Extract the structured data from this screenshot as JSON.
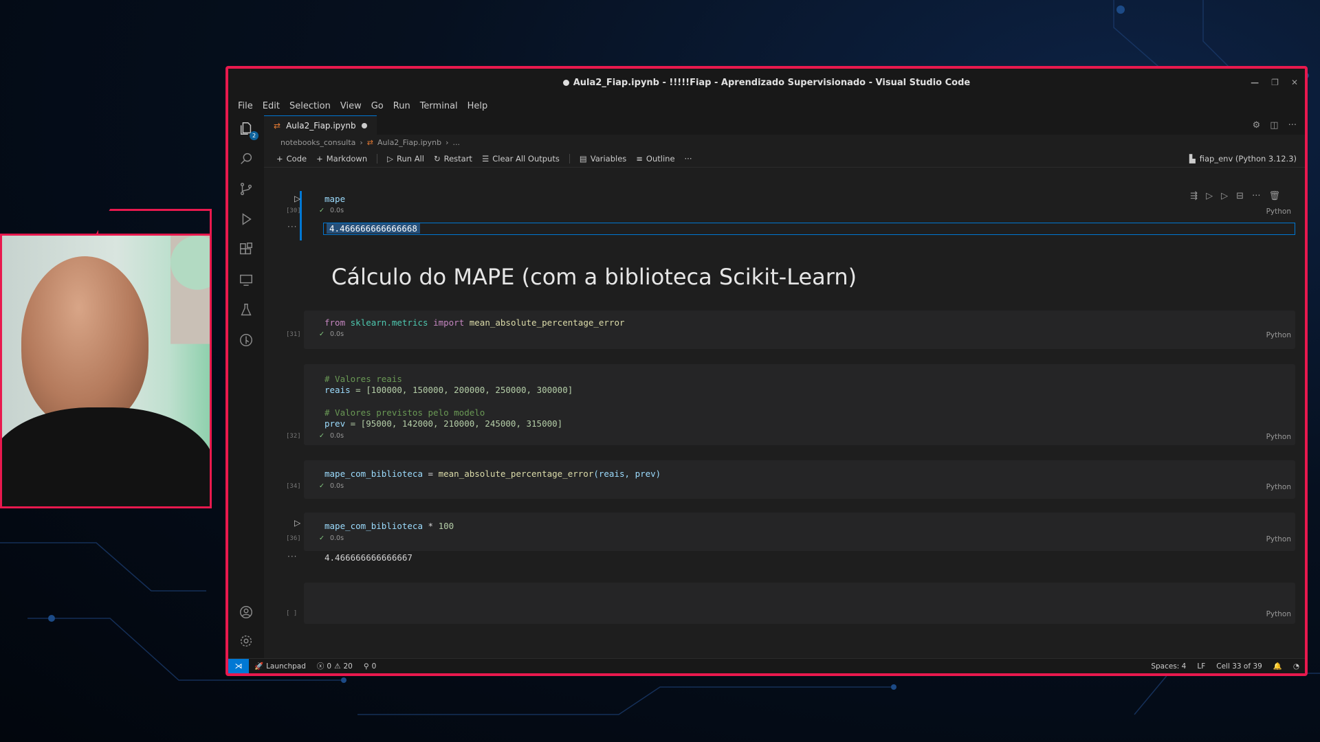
{
  "window": {
    "title": "Aula2_Fiap.ipynb - !!!!!Fiap - Aprendizado Supervisionado - Visual Studio Code"
  },
  "menu": [
    "File",
    "Edit",
    "Selection",
    "View",
    "Go",
    "Run",
    "Terminal",
    "Help"
  ],
  "tab": {
    "label": "Aula2_Fiap.ipynb"
  },
  "breadcrumb": [
    "notebooks_consulta",
    "Aula2_Fiap.ipynb",
    "..."
  ],
  "notebook_toolbar": {
    "code": "Code",
    "markdown": "Markdown",
    "run_all": "Run All",
    "restart": "Restart",
    "clear_outputs": "Clear All Outputs",
    "variables": "Variables",
    "outline": "Outline",
    "more": "···",
    "kernel": "fiap_env (Python 3.12.3)"
  },
  "cells": {
    "c1": {
      "code": "mape",
      "exec": "[30]",
      "time": "0.0s",
      "lang": "Python",
      "output": "4.466666666666668"
    },
    "heading": "Cálculo do MAPE (com a biblioteca Scikit-Learn)",
    "c2": {
      "code_kw1": "from",
      "code_mod": "sklearn.metrics",
      "code_kw2": "import",
      "code_fn": "mean_absolute_percentage_error",
      "exec": "[31]",
      "time": "0.0s",
      "lang": "Python"
    },
    "c3": {
      "cmt1": "# Valores reais",
      "line1_var": "reais",
      "line1_rest": " = [100000, 150000, 200000, 250000, 300000]",
      "cmt2": "# Valores previstos pelo modelo",
      "line2_var": "prev",
      "line2_rest": " = [95000, 142000, 210000, 245000, 315000]",
      "exec": "[32]",
      "time": "0.0s",
      "lang": "Python"
    },
    "c4": {
      "var": "mape_com_biblioteca",
      "eq": " = ",
      "fn": "mean_absolute_percentage_error",
      "args": "(reais, prev)",
      "exec": "[34]",
      "time": "0.0s",
      "lang": "Python"
    },
    "c5": {
      "var": "mape_com_biblioteca",
      "op": " * ",
      "num": "100",
      "exec": "[36]",
      "time": "0.0s",
      "lang": "Python",
      "output": "4.466666666666667"
    },
    "c6": {
      "exec": "[ ]",
      "lang": "Python"
    }
  },
  "status": {
    "launchpad": "Launchpad",
    "errors": "0",
    "warnings": "20",
    "ports": "0",
    "spaces": "Spaces: 4",
    "eol": "LF",
    "cell": "Cell 33 of 39"
  },
  "colors": {
    "accent_frame": "#e8194e",
    "vscode_blue": "#0078d4"
  }
}
